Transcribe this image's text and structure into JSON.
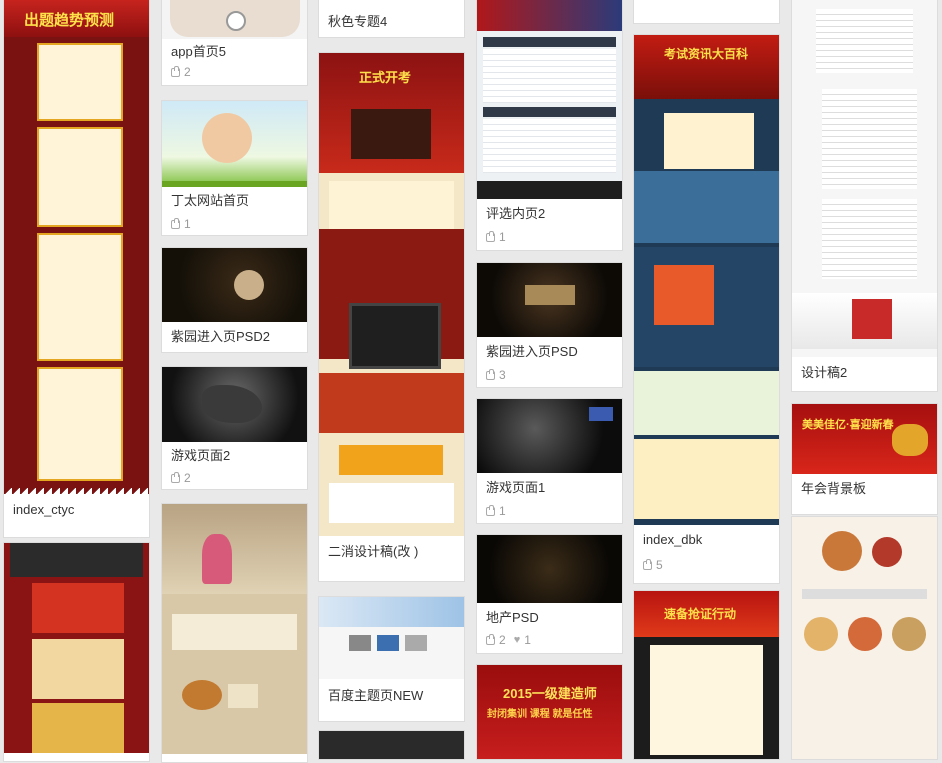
{
  "cards": [
    {
      "id": "index-ctyc",
      "title": "index_ctyc",
      "likes": "",
      "hearts": ""
    },
    {
      "id": "app-home5",
      "title": "app首页5",
      "likes": "2",
      "hearts": ""
    },
    {
      "id": "dingtai-home",
      "title": "丁太网站首页",
      "likes": "1",
      "hearts": ""
    },
    {
      "id": "ziyuan-psd2",
      "title": "紫园进入页PSD2",
      "likes": "",
      "hearts": ""
    },
    {
      "id": "game-page2",
      "title": "游戏页面2",
      "likes": "2",
      "hearts": ""
    },
    {
      "id": "autumn-4",
      "title": "秋色专题4",
      "likes": "",
      "hearts": ""
    },
    {
      "id": "erxiao",
      "title": "二消设计稿(改 )",
      "likes": "",
      "hearts": ""
    },
    {
      "id": "baidu-new",
      "title": "百度主题页NEW",
      "likes": "",
      "hearts": ""
    },
    {
      "id": "pingxuan2",
      "title": "评选内页2",
      "likes": "1",
      "hearts": ""
    },
    {
      "id": "ziyuan-psd",
      "title": "紫园进入页PSD",
      "likes": "3",
      "hearts": ""
    },
    {
      "id": "game-page1",
      "title": "游戏页面1",
      "likes": "1",
      "hearts": ""
    },
    {
      "id": "dichan-psd",
      "title": "地产PSD",
      "likes": "2",
      "hearts": "1"
    },
    {
      "id": "index-dbk",
      "title": "index_dbk",
      "likes": "5",
      "hearts": ""
    },
    {
      "id": "design2",
      "title": "设计稿2",
      "likes": "",
      "hearts": ""
    },
    {
      "id": "annual-bg",
      "title": "年会背景板",
      "likes": "",
      "hearts": ""
    }
  ],
  "thumb_text": {
    "ctyc_banner": "出题趋势预测",
    "exam_banner": "正式开考",
    "dbk_banner": "考试资讯大百科",
    "jianzao_banner": "2015一级建造师",
    "jianzao_sub": "封闭集训 课程 就是任性",
    "annual_banner": "美美佳亿·喜迎新春",
    "action_banner": "速备抢证行动"
  },
  "colors": {
    "accent_red": "#b81d1d",
    "dark_red": "#6d0f0f",
    "page_bg": "#e9e9e9"
  }
}
